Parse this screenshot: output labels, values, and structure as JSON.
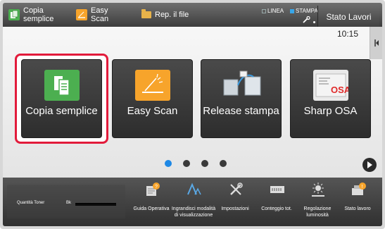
{
  "topbar": {
    "shortcuts": [
      {
        "label": "Copia semplice",
        "icon": "copy-icon"
      },
      {
        "label": "Easy Scan",
        "icon": "scan-icon"
      },
      {
        "label": "Rep. il file",
        "icon": "folder-icon"
      }
    ],
    "indicators": {
      "line": "LINEA",
      "print": "STAMPA."
    },
    "status_button": "Stato Lavori"
  },
  "main": {
    "clock": "10:15",
    "tiles": [
      {
        "label": "Copia semplice",
        "icon": "copy-icon",
        "selected": true
      },
      {
        "label": "Easy Scan",
        "icon": "scan-icon"
      },
      {
        "label": "Release stampa",
        "icon": "release-print-icon"
      },
      {
        "label": "Sharp OSA",
        "icon": "sharp-osa-icon",
        "icon_text": "OSA"
      }
    ],
    "pages": {
      "count": 4,
      "current": 1
    }
  },
  "bottombar": {
    "toner": {
      "label": "Quantità Toner",
      "color": "Bk"
    },
    "items": [
      {
        "label": "Guida Operativa",
        "icon": "guide-icon"
      },
      {
        "label": "Ingrandisci modalità di visualizzazione",
        "icon": "zoom-text-icon"
      },
      {
        "label": "Impostazioni",
        "icon": "settings-tools-icon"
      },
      {
        "label": "Conteggio tot.",
        "icon": "counter-icon"
      },
      {
        "label": "Regolazione luminosità",
        "icon": "brightness-icon"
      },
      {
        "label": "Stato lavoro",
        "icon": "job-status-icon"
      }
    ]
  },
  "colors": {
    "selection_ring": "#e21b3b",
    "copy_green": "#4caf50",
    "scan_orange": "#f7a42b",
    "active_dot": "#1e88e5"
  }
}
